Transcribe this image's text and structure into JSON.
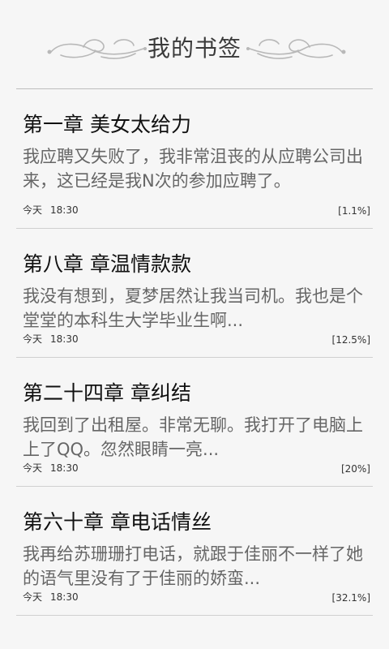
{
  "header": {
    "title": "我的书签"
  },
  "bookmarks": [
    {
      "chapter": "第一章  美女太给力",
      "summary": "我应聘又失败了，我非常沮丧的从应聘公司出来，这已经是我N次的参加应聘了。",
      "date": "今天",
      "time": "18:30",
      "progress": "[1.1%]"
    },
    {
      "chapter": "第八章  章温情款款",
      "summary": "我没有想到，夏梦居然让我当司机。我也是个堂堂的本科生大学毕业生啊...",
      "date": "今天",
      "time": "18:30",
      "progress": "[12.5%]"
    },
    {
      "chapter": "第二十四章  章纠结",
      "summary": "我回到了出租屋。非常无聊。我打开了电脑上上了QQ。忽然眼睛一亮...",
      "date": "今天",
      "time": "18:30",
      "progress": "[20%]"
    },
    {
      "chapter": "第六十章  章电话情丝",
      "summary": "我再给苏珊珊打电话，就跟于佳丽不一样了她的语气里没有了于佳丽的娇蛮...",
      "date": "今天",
      "time": "18:30",
      "progress": "[32.1%]"
    }
  ]
}
